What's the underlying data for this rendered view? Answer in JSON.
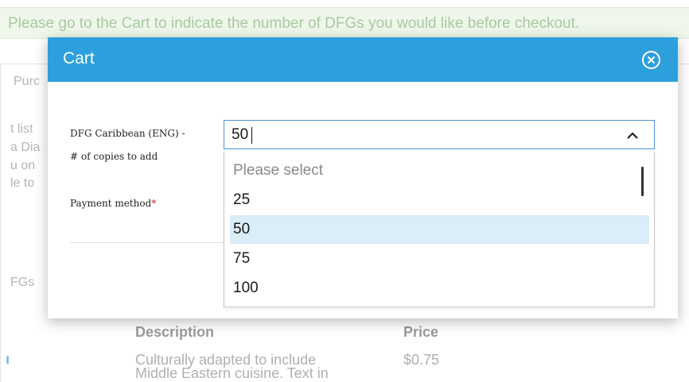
{
  "background": {
    "alert_text": "Please go to the Cart to indicate the number of DFGs you would like before checkout.",
    "left_fragments": [
      "Purc",
      "t list",
      "a Dia",
      "u on",
      "le to",
      "FGs"
    ],
    "table": {
      "col_description": "Description",
      "col_price": "Price",
      "row_description_line1": "Culturally adapted to include",
      "row_description_line2": "Middle Eastern cuisine. Text in",
      "row_price": "$0.75"
    }
  },
  "modal": {
    "title": "Cart",
    "close_icon": "close-circle-icon",
    "field_label_line1": "DFG Caribbean (ENG) -",
    "field_label_line2": "# of copies to add",
    "field_value": "50",
    "payment_label": "Payment method",
    "required_mark": "*"
  },
  "dropdown": {
    "options": [
      "Please select",
      "25",
      "50",
      "75",
      "100"
    ],
    "selected": "50"
  },
  "colors": {
    "header": "#2d9fdd",
    "selected_option": "#dbedf8",
    "input_border": "#4d8fd9",
    "required": "#cc2222"
  }
}
